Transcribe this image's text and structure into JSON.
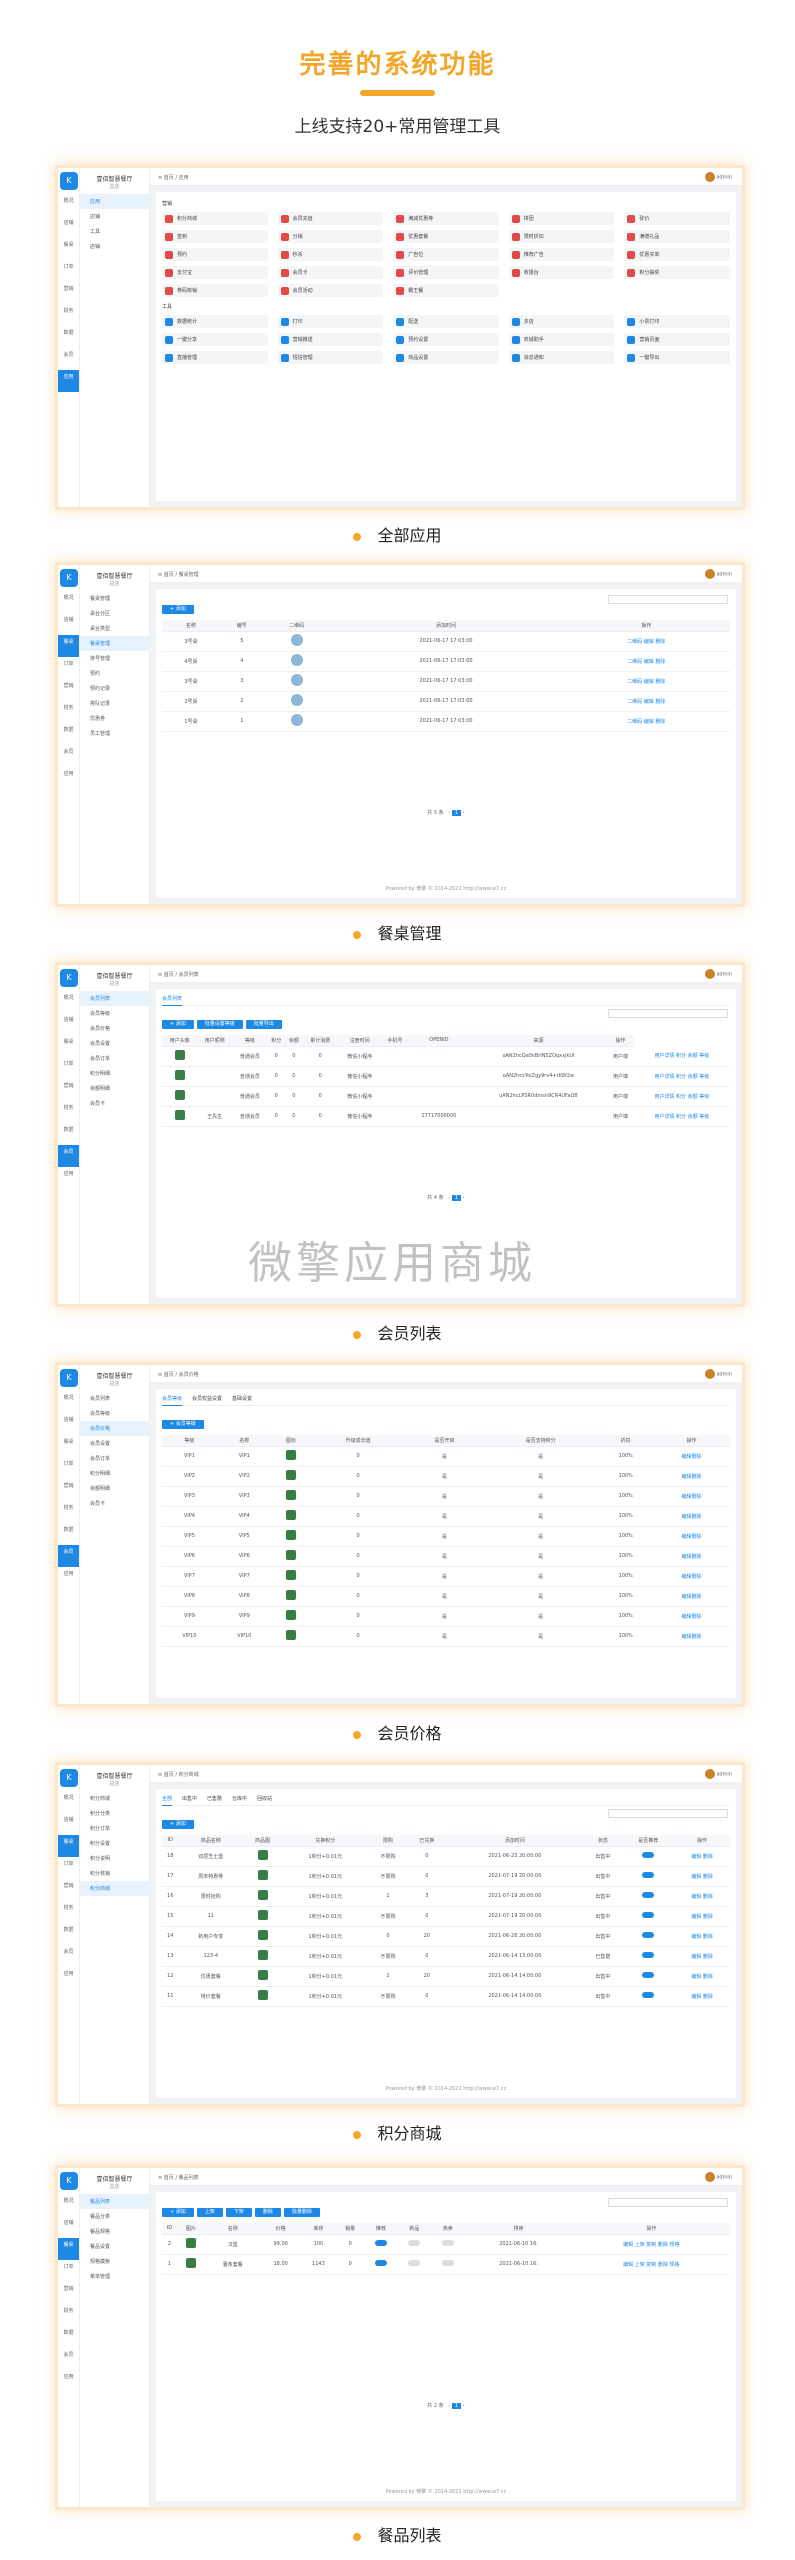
{
  "hero": {
    "title": "完善的系统功能",
    "subtitle": "上线支持20+常用管理工具"
  },
  "app": {
    "brand": "壹佰智慧餐厅",
    "brand_sub": "总店",
    "admin": "admin"
  },
  "rail": [
    "概况",
    "店铺",
    "餐桌",
    "订单",
    "营销",
    "财务",
    "数据",
    "会员",
    "应用"
  ],
  "captions": [
    "全部应用",
    "餐桌管理",
    "会员列表",
    "会员价格",
    "积分商城",
    "餐品列表"
  ],
  "watermark": "微擎应用商城",
  "s1": {
    "sub_items": [
      "应用",
      "店铺",
      "工具",
      "店铺"
    ],
    "section1": "营销",
    "section2": "工具",
    "apps1": [
      "积分商城",
      "会员充值",
      "满减优惠券",
      "拼团",
      "砍价",
      "签到",
      "分销",
      "优惠套餐",
      "限时折扣",
      "满赠礼品",
      "预约",
      "秒杀",
      "广告位",
      "推荐广告",
      "优惠买单",
      "支付宝",
      "会员卡",
      "评价管理",
      "收银台",
      "积分抽奖",
      "券码核销",
      "会员活动",
      "霸王餐"
    ],
    "apps2": [
      "数据统计",
      "打印",
      "配送",
      "多店",
      "小票打印",
      "一键分享",
      "营销推送",
      "预约设置",
      "商城助手",
      "营销页面",
      "直播管理",
      "短信管理",
      "商品设置",
      "消息通知",
      "一键导出"
    ]
  },
  "s2": {
    "sub_items": [
      "餐桌管理",
      "桌台分区",
      "桌台类型",
      "餐桌管理",
      "排号管理",
      "预约",
      "预约记录",
      "排队记录",
      "优惠券",
      "员工管理"
    ],
    "add": "+ 添加",
    "headers": [
      "名称",
      "编号",
      "二维码",
      "添加时间",
      "操作"
    ],
    "rows": [
      [
        "3号桌",
        "5",
        "2021-06-17 17:03:00",
        "二维码 编辑 删除"
      ],
      [
        "4号桌",
        "4",
        "2021-06-17 17:03:00",
        "二维码 编辑 删除"
      ],
      [
        "3号桌",
        "3",
        "2021-06-17 17:03:00",
        "二维码 编辑 删除"
      ],
      [
        "2号桌",
        "2",
        "2021-06-17 17:03:00",
        "二维码 编辑 删除"
      ],
      [
        "1号桌",
        "1",
        "2021-06-17 17:03:00",
        "二维码 编辑 删除"
      ]
    ],
    "pager": "共 5 条"
  },
  "s3": {
    "sub_items": [
      "会员列表",
      "会员等级",
      "会员价格",
      "会员设置",
      "会员订单",
      "积分明细",
      "余额明细",
      "会员卡"
    ],
    "tab": "会员列表",
    "buttons": [
      "+ 添加",
      "批量设置等级",
      "批量导出"
    ],
    "headers": [
      "用户头像",
      "用户昵称",
      "等级",
      "积分",
      "余额",
      "累计消费",
      "注册时间",
      "手机号",
      "OPENID",
      "来源",
      "操作"
    ],
    "rows": [
      [
        "",
        "普通会员",
        "0",
        "0",
        "0",
        "微信小程序",
        "",
        "",
        "oAN2hcQa5kBrlN5ZOqxxjkUl",
        "用户端",
        "用户详情 积分 余额 等级"
      ],
      [
        "",
        "普通会员",
        "0",
        "0",
        "0",
        "微信小程序",
        "",
        "",
        "oAN2hcsYoiZgy9rv4+tK8f2w",
        "用户端",
        "用户详情 积分 余额 等级"
      ],
      [
        "",
        "普通会员",
        "0",
        "0",
        "0",
        "微信小程序",
        "",
        "",
        "oAN2hcLPSR0dmsn9CR4UFaQ8",
        "用户端",
        "用户详情 积分 余额 等级"
      ],
      [
        "王先生",
        "普通会员",
        "0",
        "0",
        "0",
        "微信小程序",
        "",
        "17717000000",
        "",
        "用户端",
        "用户详情 积分 余额 等级"
      ]
    ],
    "pager": "共 4 条"
  },
  "s4": {
    "sub_items": [
      "会员列表",
      "会员等级",
      "会员价格",
      "会员设置",
      "会员订单",
      "积分明细",
      "余额明细",
      "会员卡"
    ],
    "tabs": [
      "会员等级",
      "会员权益设置",
      "基础设置"
    ],
    "add": "+ 会员等级",
    "headers": [
      "等级",
      "名称",
      "图标",
      "升级成长值",
      "是否开启",
      "是否支持积分",
      "折扣",
      "操作"
    ],
    "rows": [
      [
        "VIP1",
        "VIP1",
        "0",
        "是",
        "是",
        "100%",
        "编辑删除"
      ],
      [
        "VIP2",
        "VIP2",
        "0",
        "是",
        "是",
        "100%",
        "编辑删除"
      ],
      [
        "VIP3",
        "VIP3",
        "0",
        "是",
        "是",
        "100%",
        "编辑删除"
      ],
      [
        "VIP4",
        "VIP4",
        "0",
        "是",
        "是",
        "100%",
        "编辑删除"
      ],
      [
        "VIP5",
        "VIP5",
        "0",
        "是",
        "是",
        "100%",
        "编辑删除"
      ],
      [
        "VIP6",
        "VIP6",
        "0",
        "是",
        "是",
        "100%",
        "编辑删除"
      ],
      [
        "VIP7",
        "VIP7",
        "0",
        "是",
        "是",
        "100%",
        "编辑删除"
      ],
      [
        "VIP8",
        "VIP8",
        "0",
        "是",
        "是",
        "100%",
        "编辑删除"
      ],
      [
        "VIP9",
        "VIP9",
        "0",
        "是",
        "是",
        "100%",
        "编辑删除"
      ],
      [
        "VIP10",
        "VIP10",
        "0",
        "是",
        "是",
        "100%",
        "编辑删除"
      ]
    ]
  },
  "s5": {
    "sub_items": [
      "积分商城",
      "积分分类",
      "积分订单",
      "积分设置",
      "积分说明",
      "积分核销",
      "积分商城"
    ],
    "tabs": [
      "全部",
      "出售中",
      "已售罄",
      "仓库中",
      "回收站"
    ],
    "add": "+ 添加",
    "headers": [
      "ID",
      "商品名称",
      "商品图",
      "兑换积分",
      "限购",
      "已兑换",
      "添加时间",
      "状态",
      "是否推荐",
      "操作"
    ],
    "rows": [
      [
        "18",
        "双层芝士堡",
        "1积分+0.01元",
        "不限购",
        "0",
        "2021-06-23 20:00:00",
        "出售中",
        "编辑 删除"
      ],
      [
        "17",
        "周末特惠券",
        "1积分+0.01元",
        "不限购",
        "0",
        "2021-07-19 20:00:00",
        "出售中",
        "编辑 删除"
      ],
      [
        "16",
        "限时抢购",
        "1积分+0.01元",
        "1",
        "3",
        "2021-07-19 20:00:00",
        "出售中",
        "编辑 删除"
      ],
      [
        "15",
        "11",
        "1积分+0.01元",
        "不限购",
        "0",
        "2021-07-19 20:00:00",
        "出售中",
        "编辑 删除"
      ],
      [
        "14",
        "新用户专享",
        "1积分+0.01元",
        "0",
        "20",
        "2021-06-28 20:00:00",
        "出售中",
        "编辑 删除"
      ],
      [
        "13",
        "123-4",
        "1积分+0.01元",
        "不限购",
        "0",
        "2021-06-14 13:00:00",
        "已售罄",
        "编辑 删除"
      ],
      [
        "12",
        "优惠套餐",
        "1积分+0.01元",
        "2",
        "20",
        "2021-06-14 14:00:00",
        "出售中",
        "编辑 删除"
      ],
      [
        "11",
        "特价套餐",
        "1积分+0.01元",
        "不限购",
        "0",
        "2021-06-14 14:00:00",
        "出售中",
        "编辑 删除"
      ]
    ]
  },
  "s6": {
    "sub_items": [
      "餐品列表",
      "餐品分类",
      "餐品规格",
      "餐品设置",
      "规格模板",
      "菜单管理"
    ],
    "buttons": [
      "+ 添加",
      "上架",
      "下架",
      "删除",
      "批量删除"
    ],
    "headers": [
      "ID",
      "图片",
      "名称",
      "价格",
      "库存",
      "销量",
      "推荐",
      "新品",
      "热卖",
      "排序",
      "操作"
    ],
    "rows": [
      [
        "2",
        "汉堡",
        "99.00",
        "100",
        "0",
        "2021-06-10 16:",
        "编辑 上架 复制 删除 规格"
      ],
      [
        "1",
        "薯条套餐",
        "18.00",
        "1143",
        "0",
        "2021-06-10 16:",
        "编辑 上架 复制 删除 规格"
      ]
    ],
    "pager": "共 2 条",
    "footer": "Powered by 微擎 © 2014-2021 http://www.w7.cc"
  }
}
